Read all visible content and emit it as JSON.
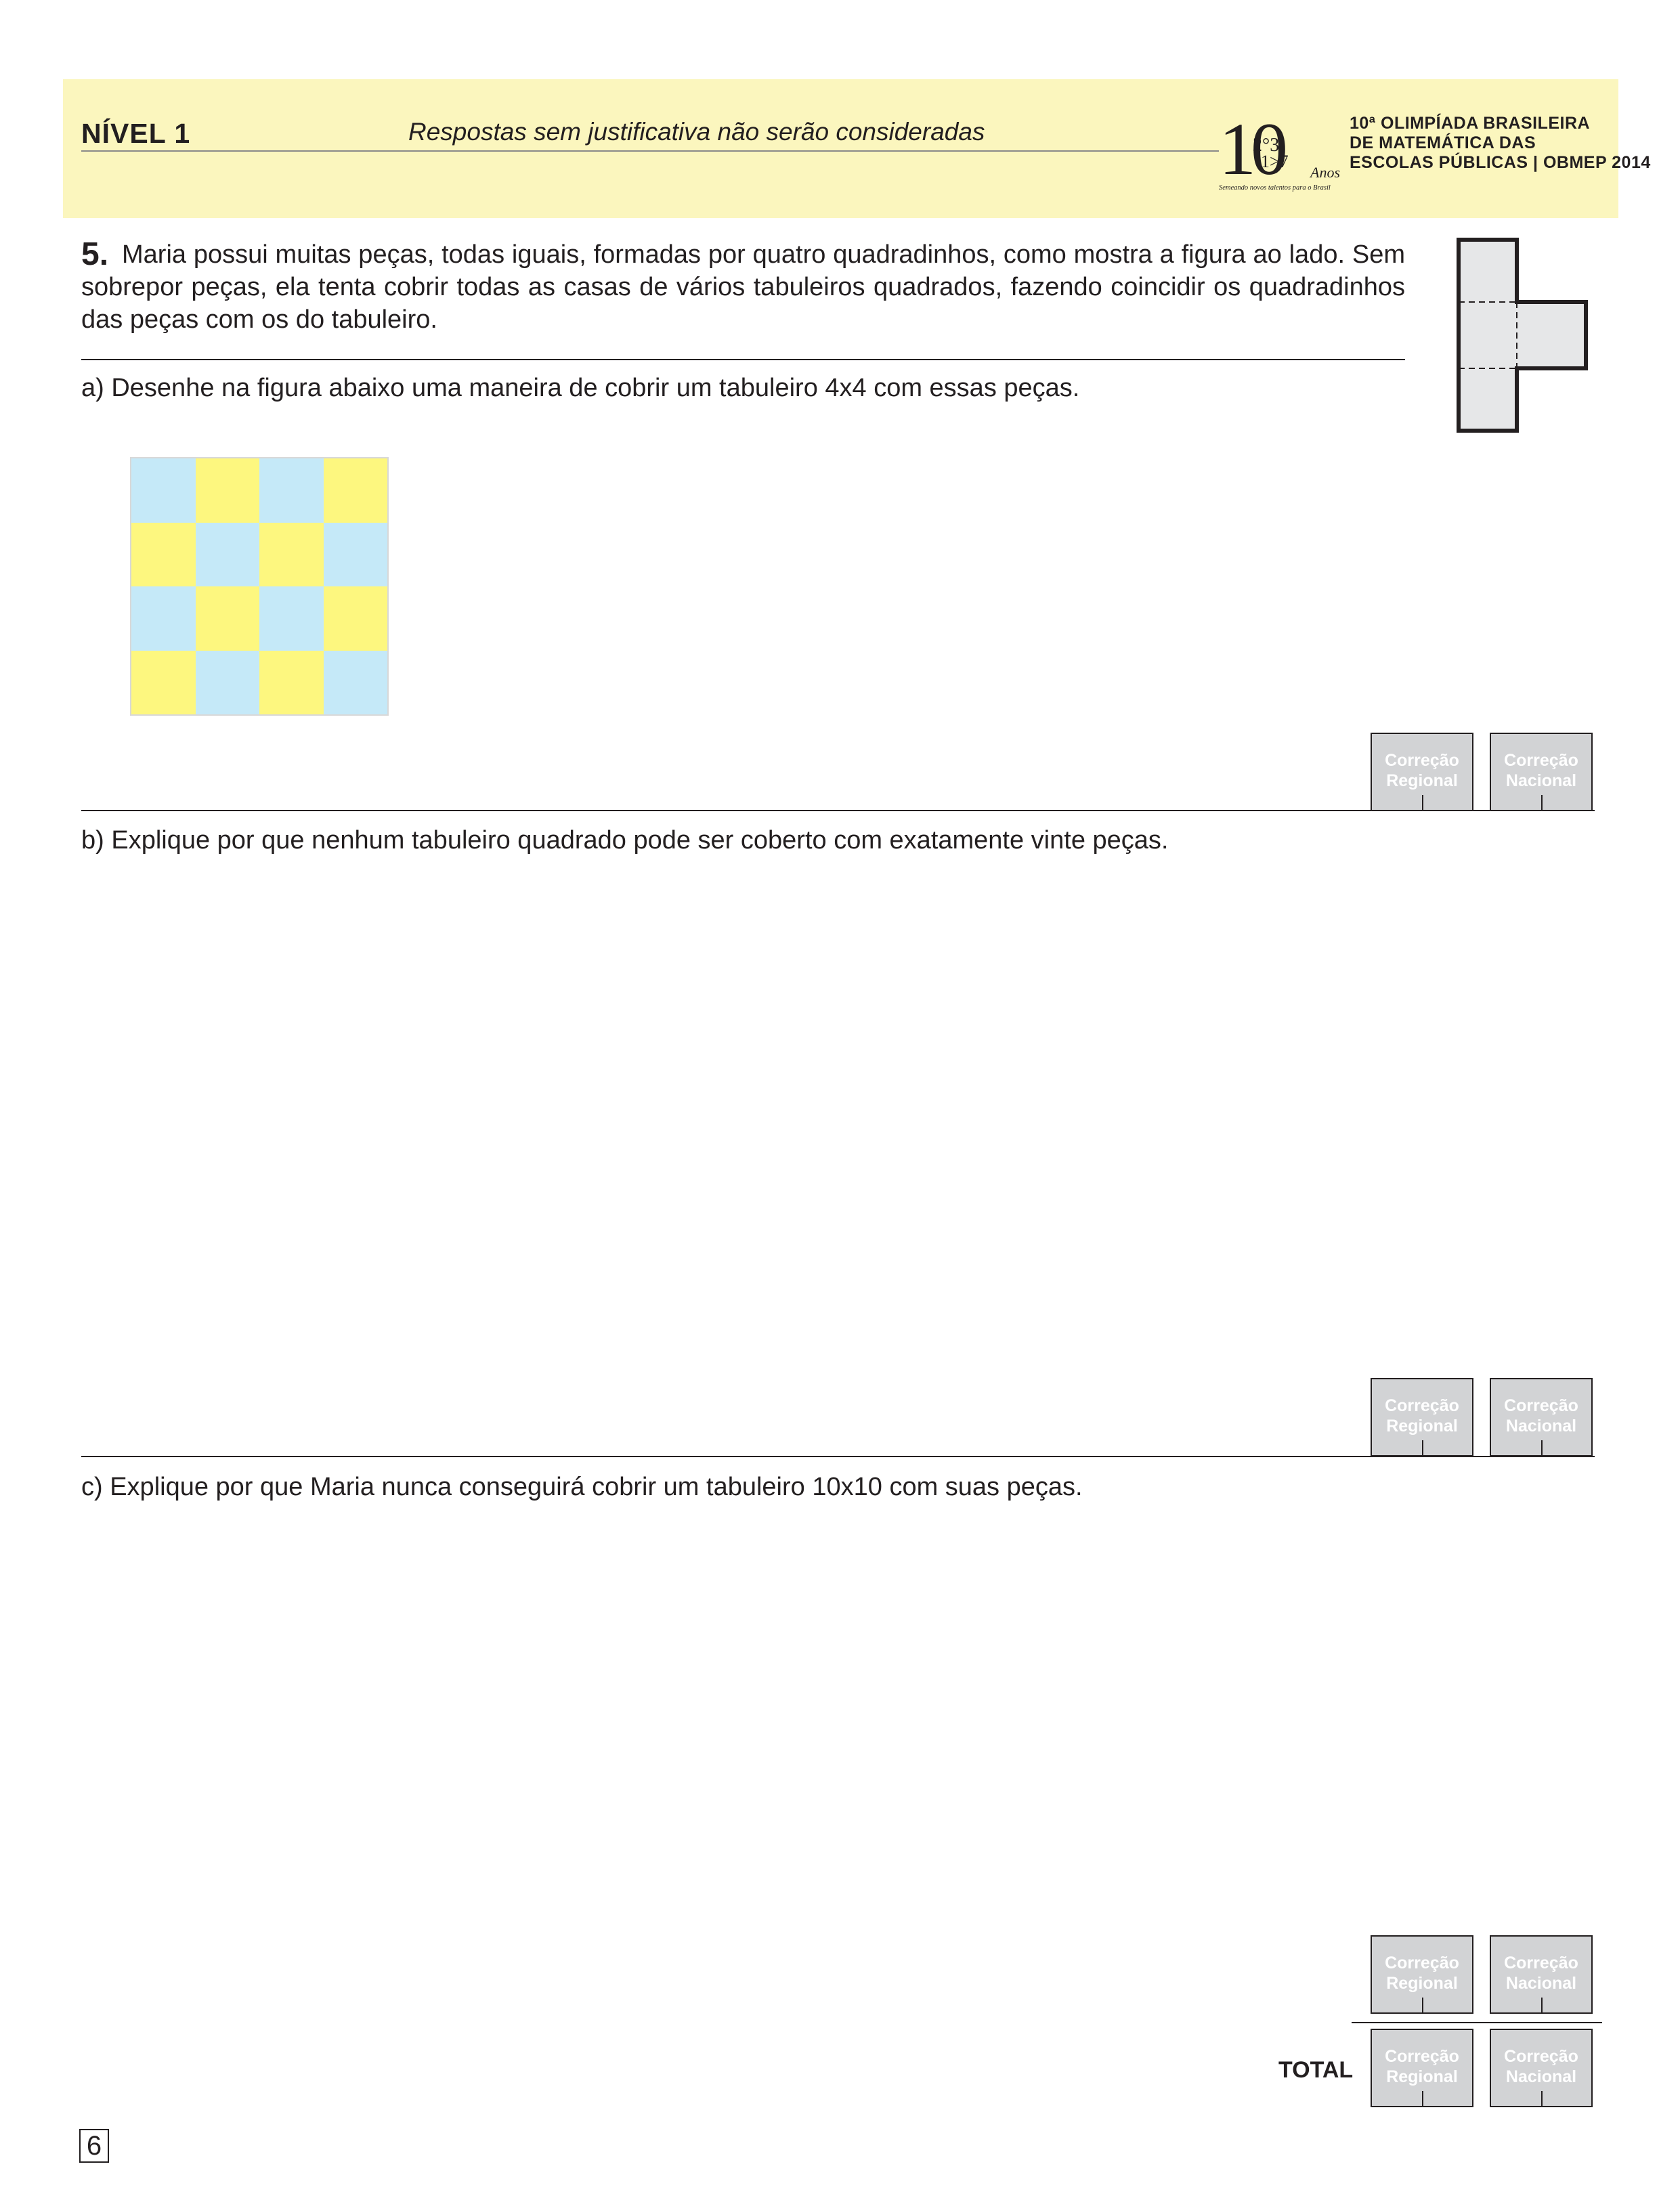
{
  "header": {
    "level": "NÍVEL 1",
    "notice": "Respostas sem justificativa não serão consideradas",
    "logo": {
      "number": "10",
      "anos": "Anos",
      "tagline": "Semeando novos talentos para o Brasil",
      "title_lines": [
        "10ª OLIMPÍADA BRASILEIRA",
        "DE MATEMÁTICA DAS",
        "ESCOLAS PÚBLICAS | OBMEP 2014"
      ]
    }
  },
  "question": {
    "number": "5.",
    "text": "Maria possui muitas peças, todas iguais, formadas por quatro quadradinhos, como mostra a figura ao lado. Sem sobrepor peças, ela tenta cobrir todas as casas de vários tabuleiros quadrados, fazendo coincidir os quadradinhos das peças com os do tabuleiro."
  },
  "parts": {
    "a": "a) Desenhe na figura abaixo uma maneira de cobrir um tabuleiro 4x4 com essas peças.",
    "b": "b) Explique por que nenhum tabuleiro quadrado pode ser coberto com exatamente vinte peças.",
    "c": "c) Explique por que Maria nunca conseguirá cobrir um tabuleiro 10x10 com suas peças."
  },
  "board": {
    "size": 4,
    "colors": {
      "blue": "#c5e9f8",
      "yellow": "#fdf77f"
    }
  },
  "correction": {
    "regional_line1": "Correção",
    "regional_line2": "Regional",
    "nacional_line1": "Correção",
    "nacional_line2": "Nacional"
  },
  "total_label": "TOTAL",
  "page_number": "6"
}
